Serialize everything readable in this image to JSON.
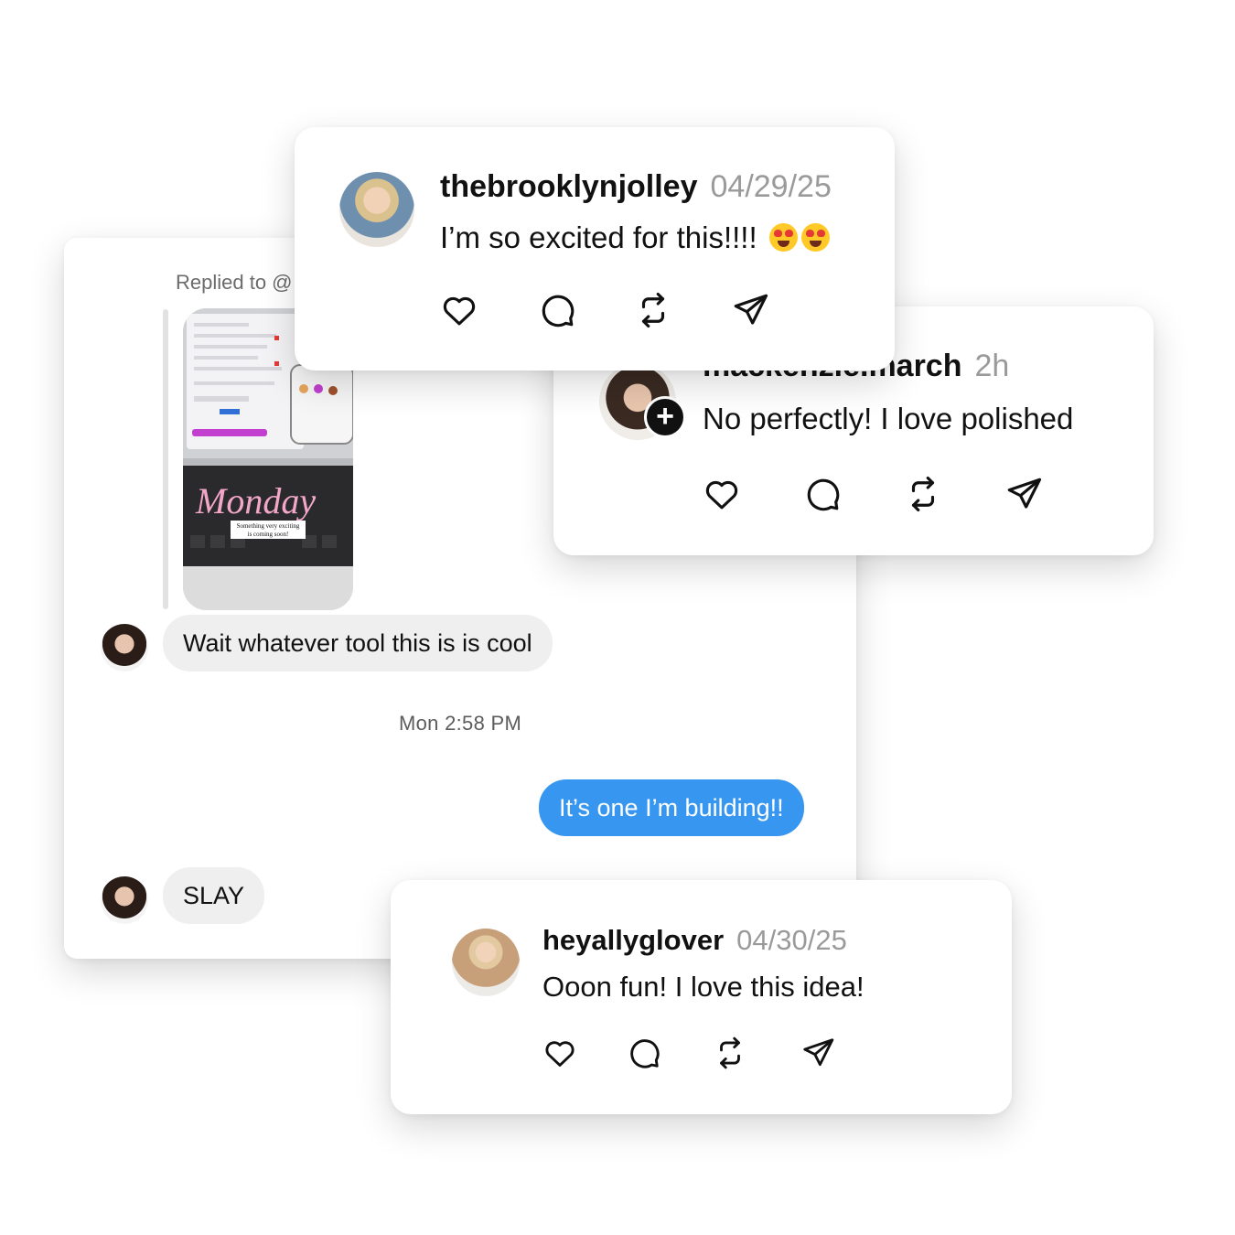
{
  "dm": {
    "replied_to": "Replied to @",
    "story_text": "Monday",
    "story_caption_1": "Something very exciting",
    "story_caption_2": "is coming soon!",
    "messages": [
      {
        "text": "Wait whatever tool this is is cool",
        "from": "them"
      },
      {
        "text": "It’s one I’m building!!",
        "from": "me"
      },
      {
        "text": "SLAY",
        "from": "them"
      }
    ],
    "timestamp": "Mon 2:58 PM"
  },
  "comments": [
    {
      "username": "thebrooklynjolley",
      "date": "04/29/25",
      "text": "I’m so excited for this!!!!"
    },
    {
      "username": "mackenzie.march",
      "date": "2h",
      "text": "No perfectly! I love polished"
    },
    {
      "username": "heyallyglover",
      "date": "04/30/25",
      "text": "Ooon fun! I love this idea!"
    }
  ],
  "icons": [
    "heart-icon",
    "comment-icon",
    "repost-icon",
    "share-icon",
    "add-icon"
  ],
  "colors": {
    "my_bubble": "#3797f0",
    "their_bubble": "#efefef",
    "date_gray": "#9a9a9a"
  }
}
